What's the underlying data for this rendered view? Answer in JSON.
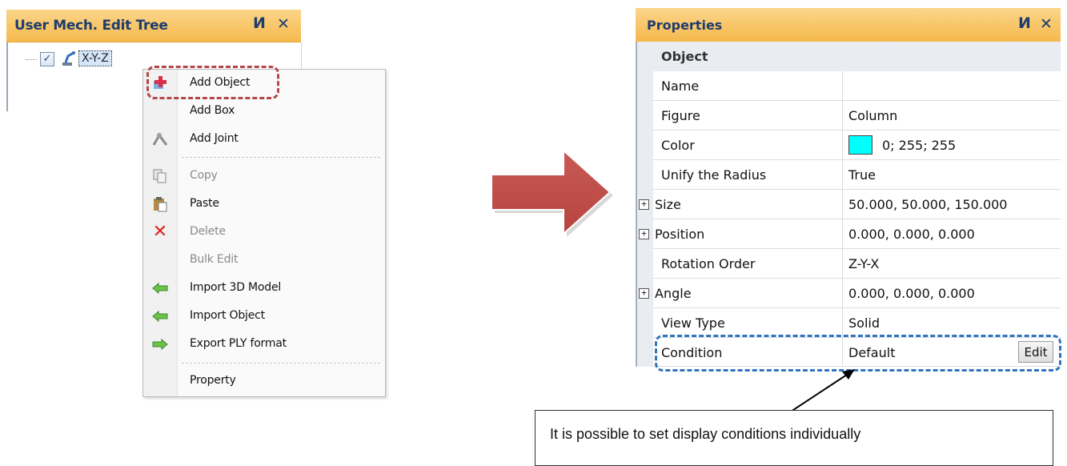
{
  "tree_panel": {
    "title": "User Mech. Edit Tree",
    "pin_glyph": "И",
    "close_glyph": "✕",
    "node_label": "X-Y-Z",
    "node_checked": true
  },
  "context_menu": {
    "items": [
      {
        "label": "Add Object",
        "icon": "add-object-icon",
        "disabled": false
      },
      {
        "label": "Add Box",
        "icon": "",
        "disabled": false
      },
      {
        "label": "Add Joint",
        "icon": "add-joint-icon",
        "disabled": false
      },
      {
        "label": "Copy",
        "icon": "copy-icon",
        "disabled": true
      },
      {
        "label": "Paste",
        "icon": "paste-icon",
        "disabled": false
      },
      {
        "label": "Delete",
        "icon": "delete-icon",
        "disabled": true
      },
      {
        "label": "Bulk Edit",
        "icon": "",
        "disabled": true
      },
      {
        "label": "Import 3D Model",
        "icon": "import-arrow-icon",
        "disabled": false
      },
      {
        "label": "Import Object",
        "icon": "import-arrow-icon",
        "disabled": false
      },
      {
        "label": "Export PLY format",
        "icon": "export-arrow-icon",
        "disabled": false
      },
      {
        "label": "Property",
        "icon": "",
        "disabled": false
      }
    ]
  },
  "properties_panel": {
    "title": "Properties",
    "pin_glyph": "И",
    "close_glyph": "✕",
    "category": "Object",
    "rows": [
      {
        "name": "Name",
        "value": ""
      },
      {
        "name": "Figure",
        "value": "Column"
      },
      {
        "name": "Color",
        "value": "0; 255; 255",
        "swatch": "#00ffff"
      },
      {
        "name": "Unify the Radius",
        "value": "True"
      },
      {
        "name": "Size",
        "value": "50.000, 50.000, 150.000",
        "expandable": true
      },
      {
        "name": "Position",
        "value": "0.000, 0.000, 0.000",
        "expandable": true
      },
      {
        "name": "Rotation Order",
        "value": "Z-Y-X"
      },
      {
        "name": "Angle",
        "value": "0.000, 0.000, 0.000",
        "expandable": true
      },
      {
        "name": "View Type",
        "value": "Solid"
      },
      {
        "name": "Condition",
        "value": "Default",
        "button": "Edit"
      }
    ]
  },
  "callout": {
    "text": "It is possible to set display conditions individually"
  },
  "colors": {
    "header_bg": "#f7c462",
    "header_text": "#1e3c6e",
    "menu_highlight": "#b5474a",
    "condition_highlight": "#2f74c0",
    "arrow": "#c0504d",
    "color_swatch": "#00ffff"
  }
}
